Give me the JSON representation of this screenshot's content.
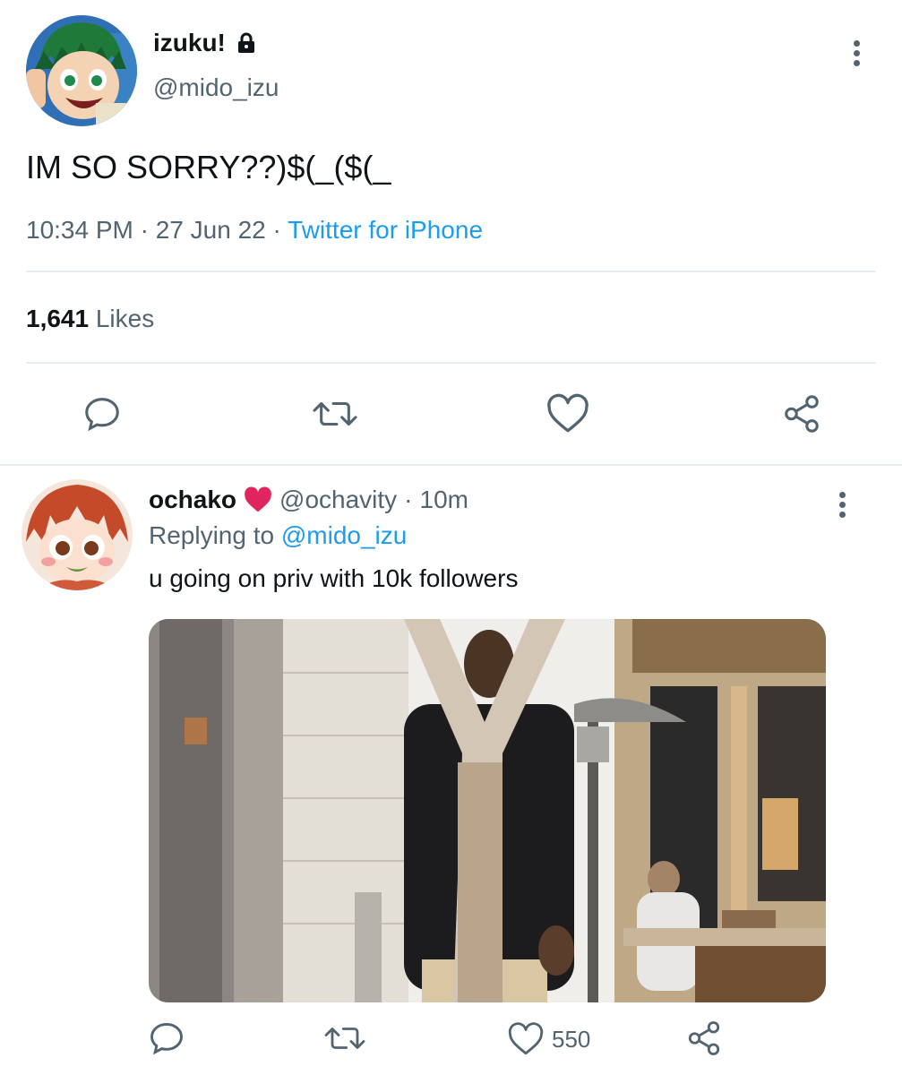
{
  "main_tweet": {
    "display_name": "izuku!",
    "handle": "@mido_izu",
    "text": "IM SO SORRY??)$(_($(_",
    "time": "10:34 PM",
    "sep1": "·",
    "date": "27 Jun 22",
    "sep2": "·",
    "source": "Twitter for iPhone",
    "likes_count": "1,641",
    "likes_label": "Likes",
    "icons": [
      "reply-icon",
      "retweet-icon",
      "like-icon",
      "share-icon"
    ]
  },
  "reply_tweet": {
    "display_name": "ochako",
    "handle": "@ochavity",
    "sep": "·",
    "time_ago": "10m",
    "replying_prefix": "Replying to",
    "replying_to": "@mido_izu",
    "text": "u going on priv with 10k followers",
    "like_count": "550",
    "icons": [
      "reply-icon",
      "retweet-icon",
      "like-icon",
      "share-icon"
    ]
  },
  "colors": {
    "accent": "#1d9bf0",
    "muted": "#536471",
    "heart_red": "#e0245e",
    "divider": "#e6ecf0"
  }
}
